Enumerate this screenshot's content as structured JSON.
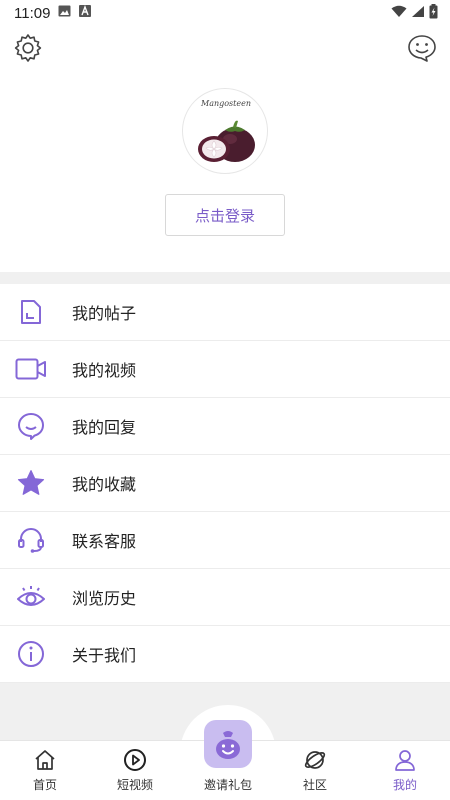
{
  "status_bar": {
    "time": "11:09",
    "icons": [
      "image-icon",
      "a-icon",
      "wifi-icon",
      "signal-icon",
      "battery-icon"
    ]
  },
  "header": {
    "settings_icon": "gear-icon",
    "message_icon": "chat-smile-icon"
  },
  "profile": {
    "avatar_caption": "Mangosteen",
    "login_label": "点击登录"
  },
  "menu": {
    "items": [
      {
        "label": "我的帖子",
        "icon": "post-icon"
      },
      {
        "label": "我的视频",
        "icon": "video-icon"
      },
      {
        "label": "我的回复",
        "icon": "reply-icon"
      },
      {
        "label": "我的收藏",
        "icon": "star-icon"
      },
      {
        "label": "联系客服",
        "icon": "headset-icon"
      },
      {
        "label": "浏览历史",
        "icon": "eye-icon"
      },
      {
        "label": "关于我们",
        "icon": "info-icon"
      }
    ]
  },
  "bottom_nav": {
    "items": [
      {
        "label": "首页",
        "icon": "home-icon"
      },
      {
        "label": "短视频",
        "icon": "play-icon"
      },
      {
        "label": "邀请礼包",
        "icon": "gift-bag-icon"
      },
      {
        "label": "社区",
        "icon": "planet-icon"
      },
      {
        "label": "我的",
        "icon": "user-icon"
      }
    ],
    "active_index": 4
  },
  "colors": {
    "accent": "#7a5cc8",
    "icon_purple": "#8467d7",
    "band_gray": "#f0f0f0"
  }
}
